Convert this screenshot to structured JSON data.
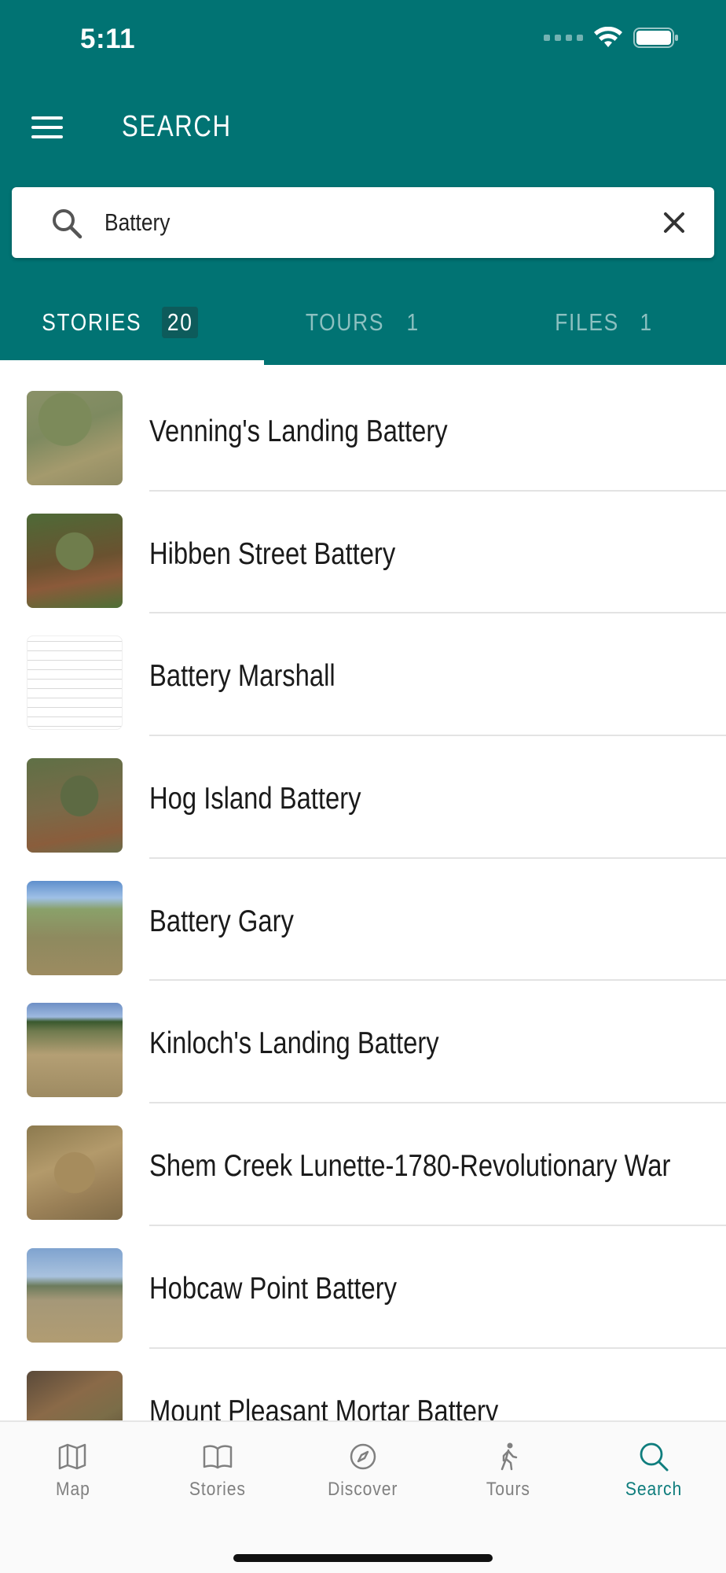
{
  "status_bar": {
    "time": "5:11"
  },
  "header": {
    "title": "SEARCH"
  },
  "search": {
    "value": "Battery",
    "placeholder": ""
  },
  "tabs": [
    {
      "label": "STORIES",
      "count": "20",
      "active": true
    },
    {
      "label": "TOURS",
      "count": "1",
      "active": false
    },
    {
      "label": "FILES",
      "count": "1",
      "active": false
    }
  ],
  "results": [
    {
      "title": "Venning's Landing Battery"
    },
    {
      "title": "Hibben Street Battery"
    },
    {
      "title": "Battery Marshall"
    },
    {
      "title": "Hog Island Battery"
    },
    {
      "title": "Battery Gary"
    },
    {
      "title": "Kinloch's Landing Battery"
    },
    {
      "title": "Shem Creek Lunette-1780-Revolutionary War"
    },
    {
      "title": "Hobcaw Point Battery"
    },
    {
      "title": "Mount Pleasant Mortar Battery"
    }
  ],
  "bottom_nav": [
    {
      "label": "Map",
      "icon": "map-icon"
    },
    {
      "label": "Stories",
      "icon": "book-icon"
    },
    {
      "label": "Discover",
      "icon": "compass-icon"
    },
    {
      "label": "Tours",
      "icon": "walking-icon"
    },
    {
      "label": "Search",
      "icon": "search-icon",
      "active": true
    }
  ],
  "colors": {
    "primary": "#017373",
    "accent": "#0f7d7d",
    "inactive": "#808080"
  }
}
